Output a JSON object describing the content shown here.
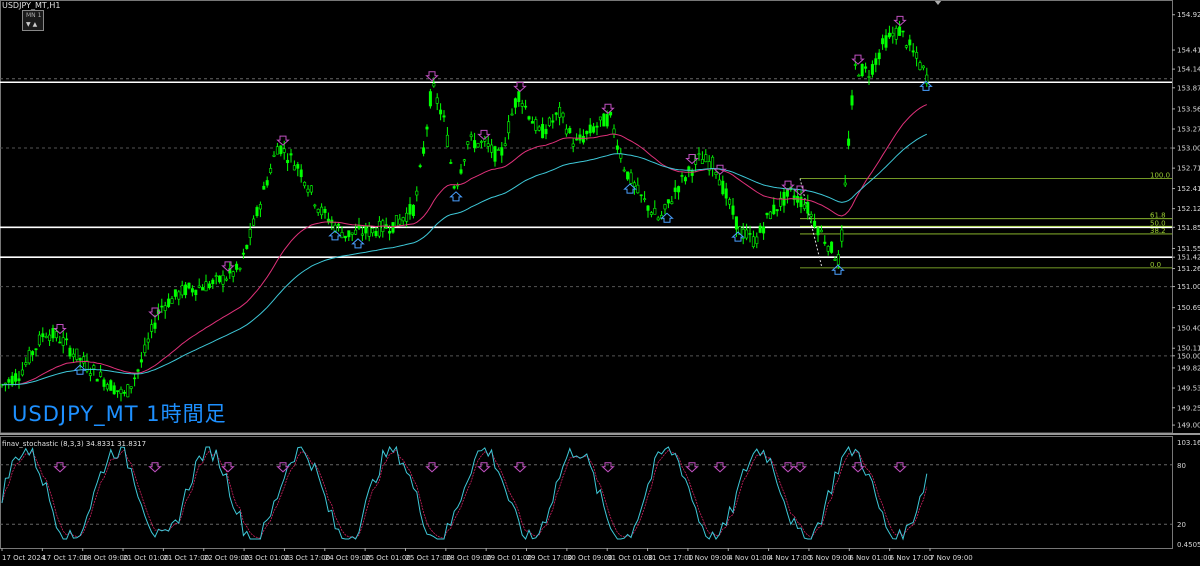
{
  "window": {
    "title": "USDJPY_MT,H1"
  },
  "timeframe_selector": {
    "label": "MN 1",
    "arrows": "▼▲"
  },
  "overlay_label": "USDJPY_MT  1時間足",
  "indicator": {
    "label": "finav_stochastic (8,3,3) 34.8331 31.8317",
    "axis_top": "103.1643",
    "axis_80": "80",
    "axis_20": "20",
    "axis_bottom": "0.4505"
  },
  "price_axis": [
    {
      "label": "154.925",
      "price": 154.925
    },
    {
      "label": "154.415",
      "price": 154.415
    },
    {
      "label": "154.140",
      "price": 154.14
    },
    {
      "label": "153.870",
      "price": 153.87
    },
    {
      "label": "153.565",
      "price": 153.565
    },
    {
      "label": "153.275",
      "price": 153.275
    },
    {
      "label": "153.000",
      "price": 153.0
    },
    {
      "label": "152.710",
      "price": 152.71
    },
    {
      "label": "152.415",
      "price": 152.415
    },
    {
      "label": "152.125",
      "price": 152.125
    },
    {
      "label": "151.856",
      "price": 151.856
    },
    {
      "label": "151.550",
      "price": 151.55
    },
    {
      "label": "151.424",
      "price": 151.424
    },
    {
      "label": "151.260",
      "price": 151.26
    },
    {
      "label": "151.000",
      "price": 151.0
    },
    {
      "label": "150.695",
      "price": 150.695
    },
    {
      "label": "150.405",
      "price": 150.405
    },
    {
      "label": "150.110",
      "price": 150.11
    },
    {
      "label": "150.000",
      "price": 150.0
    },
    {
      "label": "149.825",
      "price": 149.825
    },
    {
      "label": "149.535",
      "price": 149.535
    },
    {
      "label": "149.250",
      "price": 149.25
    },
    {
      "label": "149.000",
      "price": 149.0
    }
  ],
  "time_axis": [
    "17 Oct 2024",
    "17 Oct 17:00",
    "18 Oct 09:00",
    "21 Oct 01:00",
    "21 Oct 17:00",
    "22 Oct 09:00",
    "23 Oct 01:00",
    "23 Oct 17:00",
    "24 Oct 09:00",
    "25 Oct 01:00",
    "25 Oct 17:00",
    "28 Oct 09:00",
    "29 Oct 01:00",
    "29 Oct 17:00",
    "30 Oct 09:00",
    "31 Oct 01:00",
    "31 Oct 17:00",
    "1 Nov 09:00",
    "4 Nov 01:00",
    "4 Nov 17:00",
    "5 Nov 09:00",
    "6 Nov 01:00",
    "6 Nov 17:00",
    "7 Nov 09:00"
  ],
  "fibonacci": [
    {
      "label": "100.0",
      "price": 152.56
    },
    {
      "label": "61.8",
      "price": 151.98
    },
    {
      "label": "50.0",
      "price": 151.87
    },
    {
      "label": "38.2",
      "price": 151.76
    },
    {
      "label": "0.0",
      "price": 151.27
    }
  ],
  "horizontal_lines": [
    {
      "price": 153.95,
      "style": "solid-white"
    },
    {
      "price": 151.856,
      "style": "solid-white"
    },
    {
      "price": 151.424,
      "style": "solid-white"
    }
  ],
  "colors": {
    "bull_candle": "#00ff00",
    "bear_candle": "#00ff00",
    "ma_fast": "#e0317a",
    "ma_slow": "#3ec8d8",
    "fib": "#9acd32",
    "arrow_down": "#c050c0",
    "arrow_up": "#4aa0ff",
    "stoch_main": "#3ec8d8",
    "stoch_signal": "#d02060"
  }
}
